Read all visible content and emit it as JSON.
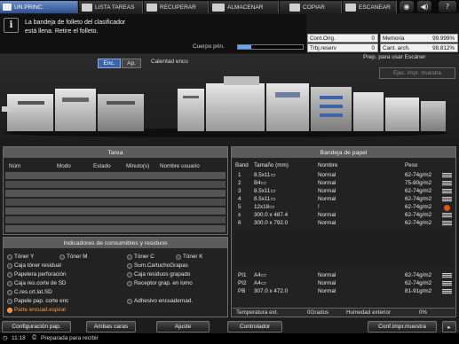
{
  "tabs": [
    {
      "label": "UN.PRINC.",
      "icon": "home-icon",
      "active": true
    },
    {
      "label": "LISTA TAREAS",
      "icon": "list-icon"
    },
    {
      "label": "RECUPERAR",
      "icon": "recall-icon"
    },
    {
      "label": "ALMACENAR",
      "icon": "store-icon"
    },
    {
      "label": "COPIAR",
      "icon": "copy-icon"
    },
    {
      "label": "ESCANEAR",
      "icon": "scan-icon"
    }
  ],
  "top_icons": [
    "globe-icon",
    "volume-icon",
    "help-icon"
  ],
  "message": {
    "line1": "La bandeja de folleto del clasificador",
    "line2": "está llena. Retire el folleto.",
    "icon": "info-icon",
    "body_label": "Cuerpo prin.",
    "body_progress": 0.2
  },
  "counters": {
    "cont_orig_label": "Cont.Orig.",
    "cont_orig_value": "0",
    "trbj_reserv_label": "Trbj.reserv",
    "trbj_reserv_value": "0",
    "memoria_label": "Memoria",
    "memoria_value": "99.999%",
    "cant_arch_label": "Cant. arch.",
    "cant_arch_value": "98.812%"
  },
  "machine": {
    "mode_on": "Enc.",
    "mode_off": "Ap.",
    "warming": "Calentad encu",
    "scanner_ready": "Prep. para usar Escáner",
    "print_sample": "Ejec. impr. muestra"
  },
  "tarea": {
    "title": "Tarea",
    "headers": [
      "Núm",
      "Modo",
      "Estado",
      "Minuto(s)",
      "Nombre usuario"
    ]
  },
  "consumibles": {
    "title": "Indicadores de consumibles y residuos",
    "items": [
      {
        "label": "Tóner Y",
        "warn": false
      },
      {
        "label": "Tóner M",
        "warn": false
      },
      {
        "label": "Tóner C",
        "warn": false
      },
      {
        "label": "Tóner K",
        "warn": false
      },
      {
        "label": "Caja tóner residual",
        "warn": false
      },
      {
        "label": "Sum.CartuchoGrapas",
        "warn": false
      },
      {
        "label": "Papelera perforación",
        "warn": false
      },
      {
        "label": "Caja residuos grapado",
        "warn": false
      },
      {
        "label": "Caja res.corte de SD",
        "warn": false
      },
      {
        "label": "Receptor grap. en lomo",
        "warn": false
      },
      {
        "label": "C.res.crt.lat.SD",
        "warn": false
      },
      {
        "label": "Papele pap. corte enc",
        "warn": false
      },
      {
        "label": "Adhesivo encuadernad.",
        "warn": false
      },
      {
        "label": "Parte encuad.espiral",
        "warn": true
      }
    ]
  },
  "bandeja": {
    "title": "Bandeja de papel",
    "headers": [
      "Band",
      "Tamaño (mm)",
      "Nombre",
      "Peso"
    ],
    "rows": [
      {
        "band": "1",
        "size": "8.5x11▭",
        "name": "Normal",
        "peso": "62-74g/m2"
      },
      {
        "band": "2",
        "size": "B4▭",
        "name": "Normal",
        "peso": "75-80g/m2"
      },
      {
        "band": "3",
        "size": "8.5x11▭",
        "name": "Normal",
        "peso": "62-74g/m2"
      },
      {
        "band": "4",
        "size": "8.5x11▭",
        "name": "Normal",
        "peso": "62-74g/m2"
      },
      {
        "band": "5",
        "size": "12x18▭",
        "name": "!",
        "peso": "62-74g/m2"
      },
      {
        "band": "±",
        "size": "300.0 x 487.4",
        "name": "Normal",
        "peso": "62-74g/m2"
      },
      {
        "band": "6",
        "size": "300.0 x 792.0",
        "name": "Normal",
        "peso": "62-74g/m2"
      },
      {
        "band": "PI1",
        "size": "A4▭",
        "name": "Normal",
        "peso": "62-74g/m2"
      },
      {
        "band": "PI2",
        "size": "A4▭",
        "name": "Normal",
        "peso": "62-74g/m2"
      },
      {
        "band": "PB",
        "size": "307.0 x 472.0",
        "name": "Normal",
        "peso": "81-91g/m2"
      }
    ],
    "temp_label": "Temperatura ext.",
    "temp_value": "0Grados",
    "hum_label": "Humedad exterior",
    "hum_value": "0%"
  },
  "bottom_buttons": {
    "config": "Configuración pap.",
    "ambas": "Ambas caras",
    "ajuste": "Ajuste",
    "controlador": "Controlador",
    "conf_muestra": "Conf.impr.muestra"
  },
  "status": {
    "time": "11:18",
    "text": "Preparada para recibir"
  },
  "colors": {
    "active_tab": "#3d64a8",
    "progress": "#62a8ff",
    "warning": "#ff8a1e"
  }
}
